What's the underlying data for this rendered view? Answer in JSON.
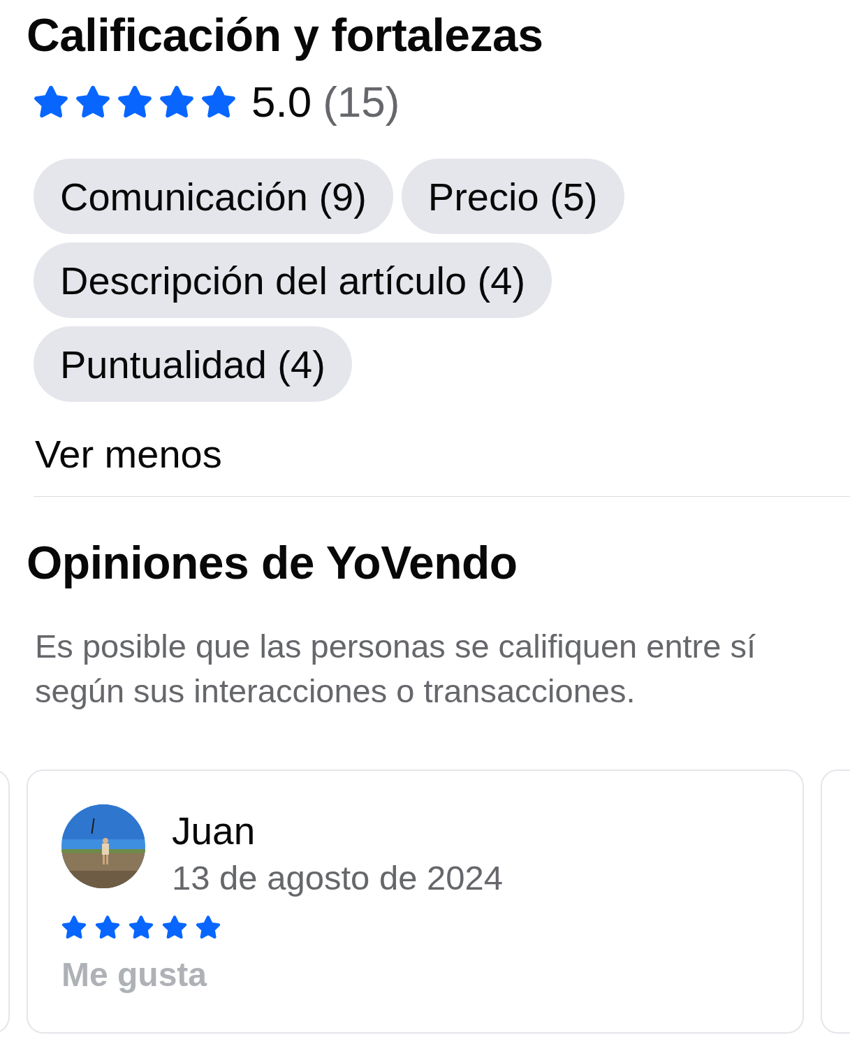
{
  "rating_section": {
    "title": "Calificación y fortalezas",
    "stars": 5,
    "score": "5.0",
    "count": "(15)",
    "strengths": [
      {
        "label": "Comunicación (9)"
      },
      {
        "label": "Precio (5)"
      },
      {
        "label": "Descripción del artículo (4)"
      },
      {
        "label": "Puntualidad (4)"
      }
    ],
    "toggle": "Ver menos"
  },
  "reviews_section": {
    "title": "Opiniones de YoVendo",
    "description": "Es posible que las personas se califiquen entre sí según sus interacciones o transacciones.",
    "reviews": [
      {
        "name": "Juan",
        "date": "13 de agosto de 2024",
        "stars": 5,
        "action": "Me gusta"
      }
    ]
  }
}
